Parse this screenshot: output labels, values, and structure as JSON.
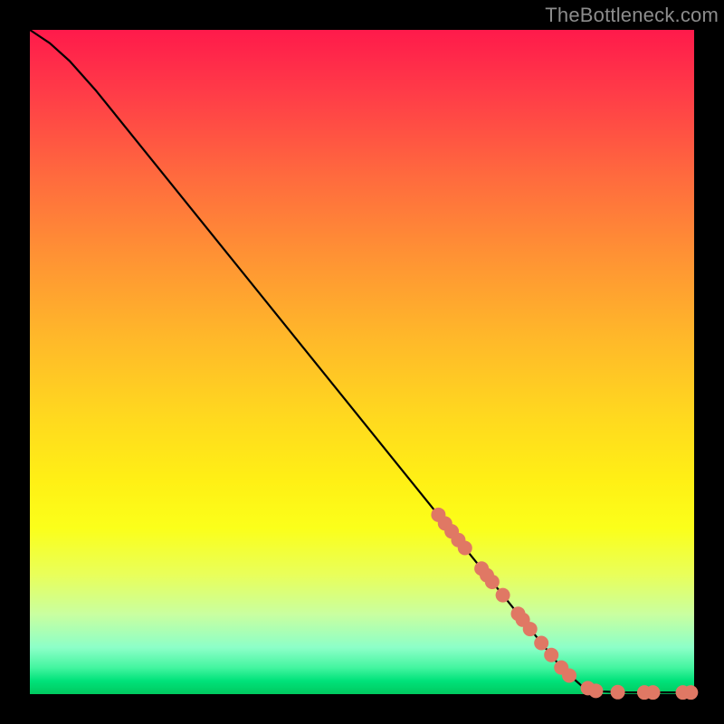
{
  "attribution": "TheBottleneck.com",
  "chart_data": {
    "type": "line",
    "title": "",
    "xlabel": "",
    "ylabel": "",
    "xlim": [
      0,
      100
    ],
    "ylim": [
      0,
      100
    ],
    "grid": false,
    "legend": false,
    "series": [
      {
        "name": "curve",
        "style": "line",
        "color": "#000000",
        "points": [
          {
            "x": 0.0,
            "y": 100.0
          },
          {
            "x": 3.0,
            "y": 98.0
          },
          {
            "x": 6.0,
            "y": 95.3
          },
          {
            "x": 10.0,
            "y": 90.8
          },
          {
            "x": 20.0,
            "y": 78.4
          },
          {
            "x": 30.0,
            "y": 66.0
          },
          {
            "x": 40.0,
            "y": 53.6
          },
          {
            "x": 50.0,
            "y": 41.2
          },
          {
            "x": 60.0,
            "y": 28.8
          },
          {
            "x": 70.0,
            "y": 16.4
          },
          {
            "x": 80.0,
            "y": 4.0
          },
          {
            "x": 83.0,
            "y": 1.3
          },
          {
            "x": 86.0,
            "y": 0.4
          },
          {
            "x": 90.0,
            "y": 0.25
          },
          {
            "x": 95.0,
            "y": 0.25
          },
          {
            "x": 100.0,
            "y": 0.25
          }
        ]
      },
      {
        "name": "markers",
        "style": "scatter",
        "color": "#e07864",
        "radius": 8,
        "points": [
          {
            "x": 61.5,
            "y": 27.0
          },
          {
            "x": 62.5,
            "y": 25.7
          },
          {
            "x": 63.5,
            "y": 24.5
          },
          {
            "x": 64.5,
            "y": 23.2
          },
          {
            "x": 65.5,
            "y": 22.0
          },
          {
            "x": 68.0,
            "y": 18.9
          },
          {
            "x": 68.8,
            "y": 17.9
          },
          {
            "x": 69.6,
            "y": 16.9
          },
          {
            "x": 71.2,
            "y": 14.9
          },
          {
            "x": 73.5,
            "y": 12.1
          },
          {
            "x": 74.2,
            "y": 11.2
          },
          {
            "x": 75.3,
            "y": 9.8
          },
          {
            "x": 77.0,
            "y": 7.7
          },
          {
            "x": 78.5,
            "y": 5.9
          },
          {
            "x": 80.0,
            "y": 4.0
          },
          {
            "x": 81.2,
            "y": 2.8
          },
          {
            "x": 84.0,
            "y": 0.9
          },
          {
            "x": 85.2,
            "y": 0.5
          },
          {
            "x": 88.5,
            "y": 0.3
          },
          {
            "x": 92.5,
            "y": 0.25
          },
          {
            "x": 93.8,
            "y": 0.25
          },
          {
            "x": 98.3,
            "y": 0.25
          },
          {
            "x": 99.5,
            "y": 0.25
          }
        ]
      }
    ]
  }
}
